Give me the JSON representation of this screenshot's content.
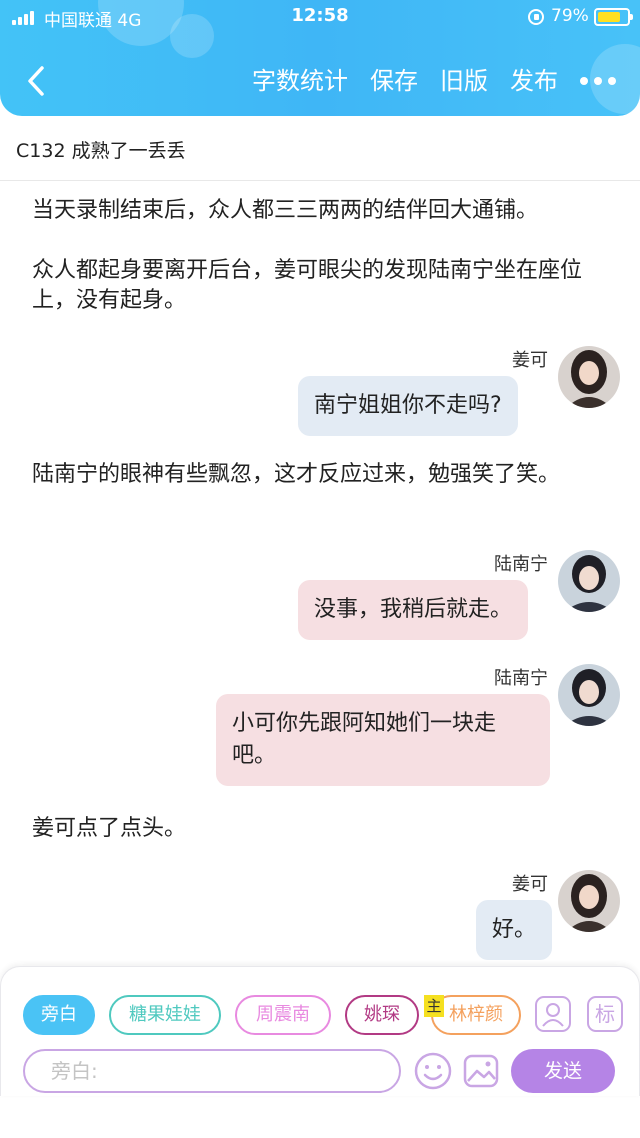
{
  "status_bar": {
    "carrier": "中国联通  4G",
    "time": "12:58",
    "battery_percent": "79%",
    "battery_level": 0.79,
    "battery_color": "#ffe020"
  },
  "nav": {
    "back_icon": "chevron-left-icon",
    "actions": [
      "字数统计",
      "保存",
      "旧版",
      "发布"
    ],
    "more_icon": "more-dots-icon"
  },
  "chapter": {
    "title": "C132  成熟了一丢丢"
  },
  "content": {
    "narration_1": "当天录制结束后，众人都三三两两的结伴回大通铺。",
    "narration_2": "众人都起身要离开后台，姜可眼尖的发现陆南宁坐在座位上，没有起身。",
    "msg_1": {
      "speaker": "姜可",
      "text": "南宁姐姐你不走吗?"
    },
    "narration_3": "陆南宁的眼神有些飘忽，这才反应过来，勉强笑了笑。",
    "msg_2": {
      "speaker": "陆南宁",
      "text": "没事，我稍后就走。"
    },
    "msg_3": {
      "speaker": "陆南宁",
      "text": "小可你先跟阿知她们一块走吧。"
    },
    "narration_4": "姜可点了点头。",
    "msg_4": {
      "speaker": "姜可",
      "text": "好。"
    }
  },
  "toolbar": {
    "characters": [
      {
        "label": "旁白",
        "color": "#4ac3f5",
        "active": true
      },
      {
        "label": "糖果娃娃",
        "color": "#4fc9bf"
      },
      {
        "label": "周震南",
        "color": "#e88ae0"
      },
      {
        "label": "姚琛",
        "color": "#b23a84"
      },
      {
        "label": "林梓颜",
        "color": "#f4a15e"
      }
    ],
    "main_tag": "主",
    "role_icon": "person-card-icon",
    "mark_label": "标",
    "input_placeholder": "旁白:",
    "emoji_icon": "smiley-icon",
    "image_icon": "image-icon",
    "send_label": "发送",
    "accent_color": "#b584e6"
  }
}
